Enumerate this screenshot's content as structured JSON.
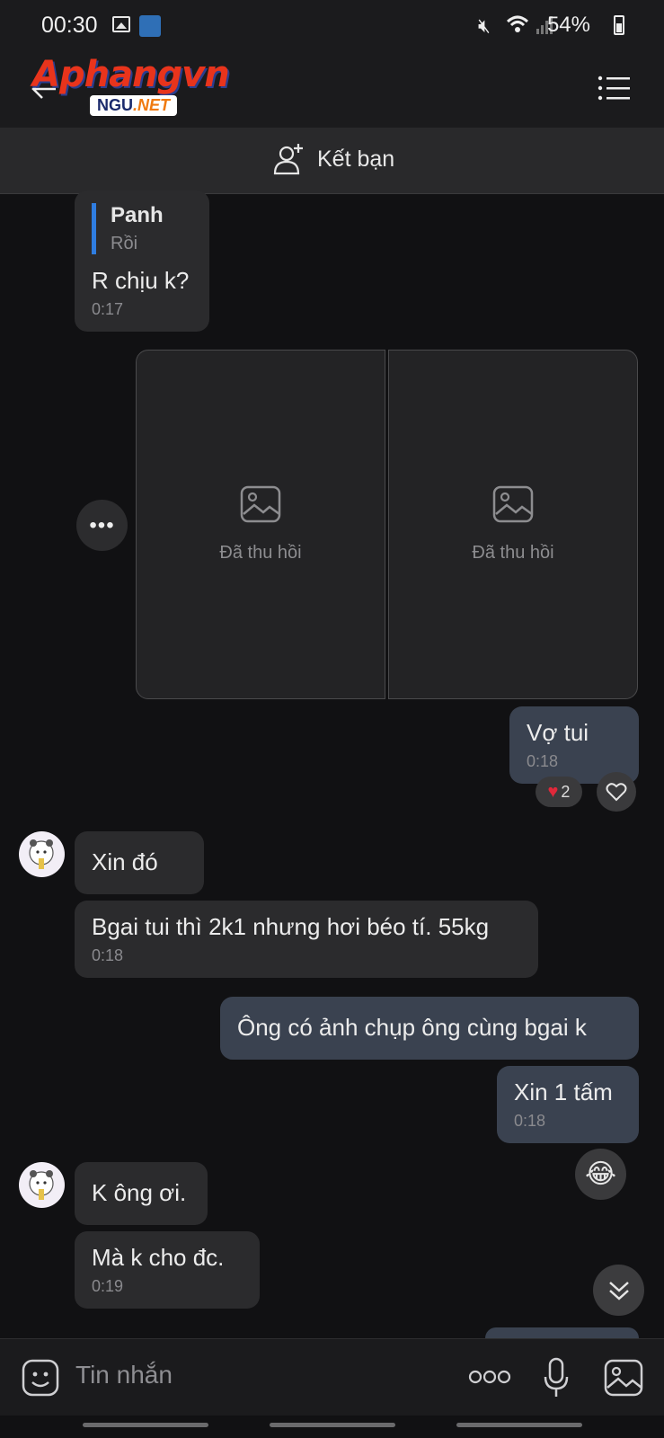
{
  "status_bar": {
    "time": "00:30",
    "battery": "54%"
  },
  "header": {
    "logo_main": "Aphangvn",
    "logo_sub_left": "NGU",
    "logo_sub_right": ".NET"
  },
  "friend_bar": {
    "label": "Kết bạn"
  },
  "messages": [
    {
      "dir": "in",
      "quote_name": "Panh",
      "quote_text": "Rồi",
      "text": "R chịu k?",
      "time": "0:17"
    },
    {
      "dir": "in",
      "type": "photos",
      "photos": [
        {
          "label": "Đã thu hồi"
        },
        {
          "label": "Đã thu hồi"
        }
      ]
    },
    {
      "dir": "out",
      "text": "Vợ tui",
      "time": "0:18",
      "reaction_count": "2"
    },
    {
      "dir": "in",
      "text": "Xin đó"
    },
    {
      "dir": "in",
      "text": "Bgai tui thì 2k1 nhưng hơi béo tí. 55kg",
      "time": "0:18"
    },
    {
      "dir": "out",
      "text": "Ông có ảnh chụp ông cùng bgai k"
    },
    {
      "dir": "out",
      "text": "Xin 1 tấm",
      "time": "0:18"
    },
    {
      "dir": "in",
      "text": "K ông ơi."
    },
    {
      "dir": "in",
      "text": "Mà k cho đc.",
      "time": "0:19"
    }
  ],
  "input": {
    "placeholder": "Tin nhắn"
  },
  "colors": {
    "background": "#111113",
    "incoming_bubble": "#2b2b2d",
    "outgoing_bubble": "#3a4250",
    "quote_bar": "#2f7de1"
  }
}
